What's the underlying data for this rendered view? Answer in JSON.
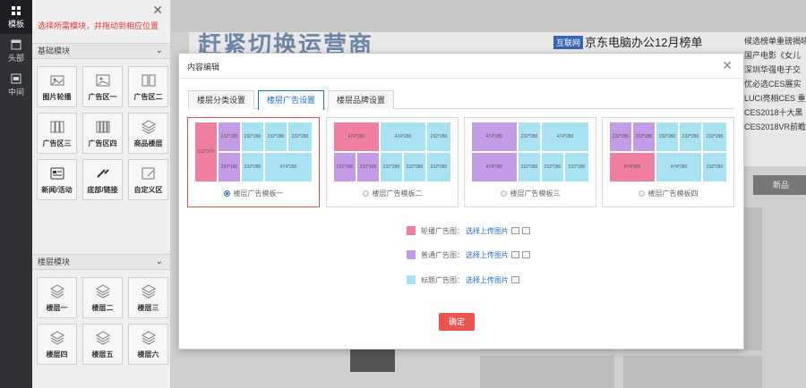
{
  "rail": {
    "items": [
      {
        "label": "模板",
        "icon": "grid-icon"
      },
      {
        "label": "头部",
        "icon": "header-icon"
      },
      {
        "label": "中间",
        "icon": "middle-icon"
      }
    ]
  },
  "panel": {
    "hint": "选择所需模块，并拖动到相应位置",
    "basic_title": "基础模块",
    "basic_items": [
      "图片轮播",
      "广告区一",
      "广告区二",
      "广告区三",
      "广告区四",
      "商品楼层",
      "新闻/活动",
      "底部/链接",
      "自定义区"
    ],
    "floor_title": "楼层模块",
    "floor_items": [
      "楼层一",
      "楼层二",
      "楼层三",
      "楼层四",
      "楼层五",
      "楼层六"
    ]
  },
  "site": {
    "banner": "赶紧切换运营商",
    "tag": "互联网",
    "headline": "京东电脑办公12月榜单",
    "news": [
      "候选榜单重磅揭晓",
      "国产电影《女儿",
      "深圳华强电子交",
      "优必选CES展实",
      "LUCI亮相CES 重",
      "CES2018十大黑",
      "CES2018VR前瞻"
    ],
    "button": "新品"
  },
  "modal": {
    "title": "内容编辑",
    "tabs": [
      "楼层分类设置",
      "楼层广告设置",
      "楼层品牌设置"
    ],
    "active_tab": 1,
    "templates": [
      {
        "label": "楼层广告模板一",
        "selected": true,
        "blocks": [
          {
            "t": "pink",
            "text": "232*370"
          },
          {
            "t": "purple",
            "text": "232*180"
          },
          {
            "t": "purple",
            "text": "232*180"
          },
          {
            "t": "cyan",
            "text": "232*280"
          },
          {
            "t": "cyan",
            "text": "232*280"
          },
          {
            "t": "cyan",
            "text": "232*280"
          },
          {
            "t": "cyan",
            "text": "232*280"
          },
          {
            "t": "cyan",
            "text": "474*280"
          }
        ]
      },
      {
        "label": "楼层广告模板二",
        "selected": false,
        "blocks": [
          {
            "t": "pink",
            "text": "474*280"
          },
          {
            "t": "purple",
            "text": "232*180"
          },
          {
            "t": "purple",
            "text": "232*180"
          },
          {
            "t": "cyan",
            "text": "474*280"
          },
          {
            "t": "cyan",
            "text": "232*280"
          },
          {
            "t": "cyan",
            "text": "232*280"
          },
          {
            "t": "cyan",
            "text": "232*280"
          },
          {
            "t": "cyan",
            "text": "232*280"
          }
        ]
      },
      {
        "label": "楼层广告模板三",
        "selected": false,
        "blocks": [
          {
            "t": "purple",
            "text": "474*280"
          },
          {
            "t": "purple",
            "text": "474*280"
          },
          {
            "t": "cyan",
            "text": "232*280"
          },
          {
            "t": "cyan",
            "text": "474*280"
          },
          {
            "t": "cyan",
            "text": "232*280"
          },
          {
            "t": "cyan",
            "text": "232*280"
          },
          {
            "t": "cyan",
            "text": "232*280"
          }
        ]
      },
      {
        "label": "楼层广告模板四",
        "selected": false,
        "blocks": [
          {
            "t": "purple",
            "text": "232*280"
          },
          {
            "t": "purple",
            "text": "232*280"
          },
          {
            "t": "cyan",
            "text": "232*280"
          },
          {
            "t": "cyan",
            "text": "232*280"
          },
          {
            "t": "cyan",
            "text": "232*280"
          },
          {
            "t": "pink",
            "text": "474*280"
          },
          {
            "t": "cyan",
            "text": "474*280"
          },
          {
            "t": "cyan",
            "text": "232*280"
          }
        ]
      }
    ],
    "legend": [
      {
        "label": "轮播广告图：",
        "link": "选择上传图片",
        "color": "#f07ea0",
        "icons": 2
      },
      {
        "label": "普通广告图：",
        "link": "选择上传图片",
        "color": "#c39be6",
        "icons": 2
      },
      {
        "label": "标题广告图：",
        "link": "选择上传图片",
        "color": "#a9e2f2",
        "icons": 1
      }
    ],
    "confirm": "确定"
  },
  "colors": {
    "pink": "#f07ea0",
    "purple": "#c39be6",
    "cyan": "#a9e2f2",
    "accent": "#1a6fd1",
    "confirm": "#e8574f"
  }
}
